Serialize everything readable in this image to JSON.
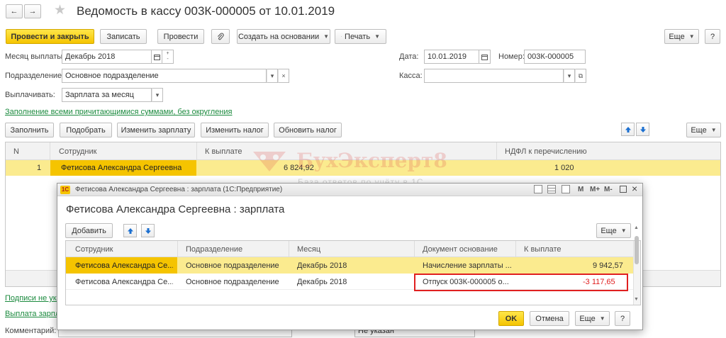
{
  "window": {
    "title": "Ведомость в кассу 003К-000005 от 10.01.2019",
    "nav_back": "←",
    "nav_forward": "→",
    "star": "★"
  },
  "toolbar": {
    "post_close": "Провести и закрыть",
    "save": "Записать",
    "post": "Провести",
    "attach_icon": "paperclip-icon",
    "create_based": "Создать на основании",
    "print": "Печать",
    "more": "Еще",
    "help": "?"
  },
  "form": {
    "month_label": "Месяц выплаты:",
    "month_value": "Декабрь 2018",
    "date_label": "Дата:",
    "date_value": "10.01.2019",
    "number_label": "Номер:",
    "number_value": "003К-000005",
    "dept_label": "Подразделение:",
    "dept_value": "Основное подразделение",
    "cash_label": "Касса:",
    "cash_value": "",
    "pay_label": "Выплачивать:",
    "pay_value": "Зарплата за месяц",
    "fill_link": "Заполнение всеми причитающимися суммами, без округления"
  },
  "table_toolbar": {
    "fill": "Заполнить",
    "select": "Подобрать",
    "edit_salary": "Изменить зарплату",
    "edit_tax": "Изменить налог",
    "update_tax": "Обновить налог",
    "more": "Еще"
  },
  "main_table": {
    "headers": [
      "N",
      "Сотрудник",
      "К выплате",
      "НДФЛ к перечислению"
    ],
    "rows": [
      {
        "n": "1",
        "employee": "Фетисова Александра Сергеевна",
        "amount": "6 824,92",
        "tax": "1 020"
      }
    ]
  },
  "watermark": {
    "title": "БухЭксперт8",
    "subtitle": "База ответов по учёту в 1С"
  },
  "bottom": {
    "signatures_link": "Подписи не ука",
    "payment_link": "Выплата зарпл",
    "comment_label": "Комментарий:",
    "not_specified": "Не указан"
  },
  "dialog": {
    "titlebar": "Фетисова Александра Сергеевна : зарплата  (1С:Предприятие)",
    "titlebar_icons": [
      "M",
      "M+",
      "M-"
    ],
    "heading": "Фетисова Александра Сергеевна : зарплата",
    "add": "Добавить",
    "more": "Еще",
    "headers": [
      "Сотрудник",
      "Подразделение",
      "Месяц",
      "Документ основание",
      "К выплате"
    ],
    "rows": [
      {
        "employee": "Фетисова Александра Се...",
        "dept": "Основное подразделение",
        "month": "Декабрь 2018",
        "doc": "Начисление зарплаты ...",
        "amount": "9 942,57"
      },
      {
        "employee": "Фетисова Александра Се...",
        "dept": "Основное подразделение",
        "month": "Декабрь 2018",
        "doc": "Отпуск 003К-000005 о...",
        "amount": "-3 117,65"
      }
    ],
    "ok": "OK",
    "cancel": "Отмена",
    "help": "?"
  },
  "colors": {
    "accent_yellow": "#f5c400",
    "row_highlight": "#fbeb8f",
    "link_green": "#1b8a3e",
    "negative_red": "#e02020"
  }
}
